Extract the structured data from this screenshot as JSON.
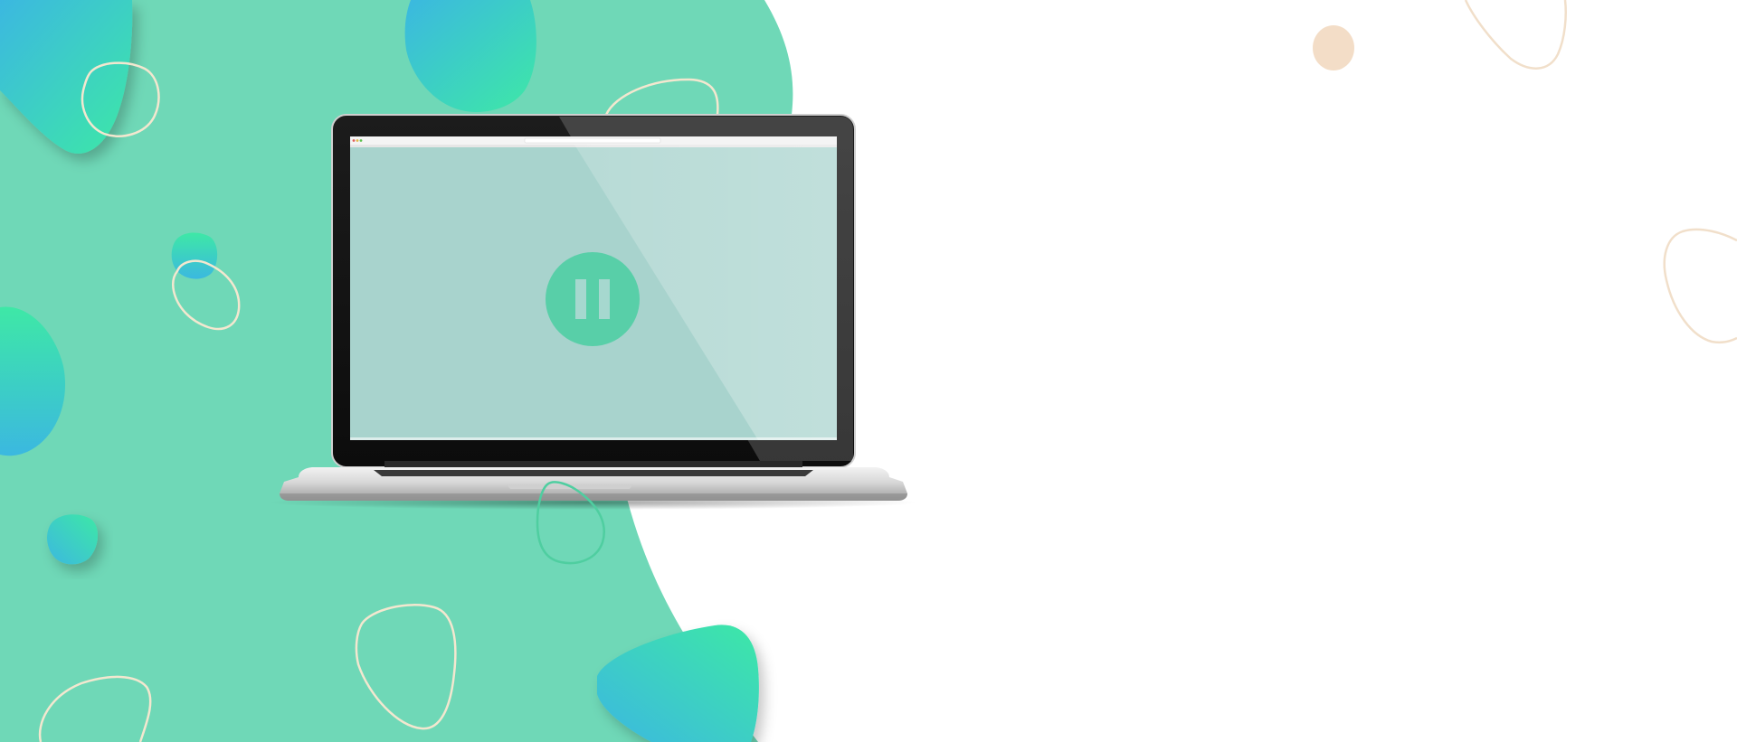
{
  "colors": {
    "background": "#ffffff",
    "mint_panel": "#6fd8b7",
    "blob_gradient_start": "#3bb8e0",
    "blob_gradient_end": "#3ee8a6",
    "outline_cream": "#f3e7cf",
    "outline_peach": "#f1dfca",
    "peach_dot": "#f3ddc7",
    "screen_tint": "#a8d3cd",
    "pause_button": "#58cfa8",
    "pause_bars": "#a6d8cf",
    "green_outline": "#4fcea0"
  },
  "icons": {
    "pause": "pause-icon"
  },
  "player": {
    "state": "paused"
  }
}
